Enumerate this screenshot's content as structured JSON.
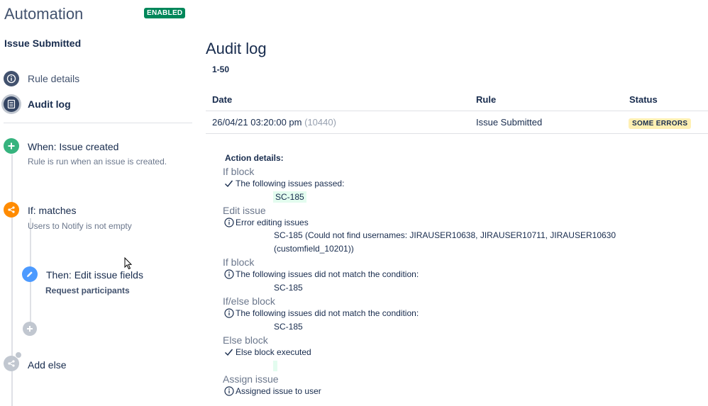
{
  "sidebar": {
    "app_title": "Automation",
    "status_badge": "ENABLED",
    "rule_name": "Issue Submitted",
    "nav": [
      {
        "label": "Rule details",
        "icon": "info-icon"
      },
      {
        "label": "Audit log",
        "icon": "list-icon",
        "active": true
      }
    ],
    "components": [
      {
        "type": "trigger",
        "title": "When: Issue created",
        "subtitle": "Rule is run when an issue is created.",
        "icon": "plus-icon",
        "color": "#36b37e"
      },
      {
        "type": "condition",
        "title": "If: matches",
        "subtitle": "Users to Notify is not empty",
        "icon": "branch-icon",
        "color": "#ff8b00"
      },
      {
        "type": "action",
        "title": "Then: Edit issue fields",
        "subtitle": "Request participants",
        "icon": "pencil-icon",
        "color": "#4c9aff"
      },
      {
        "type": "add",
        "icon": "plus-icon",
        "color": "#c1c7d0"
      },
      {
        "type": "else",
        "title": "Add else",
        "icon": "branch-icon",
        "color": "#c1c7d0"
      }
    ]
  },
  "main": {
    "title": "Audit log",
    "range": "1-50",
    "columns": {
      "date": "Date",
      "rule": "Rule",
      "status": "Status"
    },
    "row": {
      "date": "26/04/21 03:20:00 pm",
      "id": "(10440)",
      "rule": "Issue Submitted",
      "status": "SOME ERRORS"
    },
    "details": {
      "heading": "Action details:",
      "blocks": [
        {
          "title": "If block",
          "icon": "check-icon",
          "message": "The following issues passed:",
          "issue": "SC-185"
        },
        {
          "title": "Edit issue",
          "icon": "info-icon",
          "message": "Error editing issues",
          "issue_line1": "SC-185 (Could not find usernames: JIRAUSER10638, JIRAUSER10711, JIRAUSER10630",
          "issue_line2": "(customfield_10201))"
        },
        {
          "title": "If block",
          "icon": "info-icon",
          "message": "The following issues did not match the condition:",
          "issue": "SC-185"
        },
        {
          "title": "If/else block",
          "icon": "info-icon",
          "message": "The following issues did not match the condition:",
          "issue": "SC-185"
        },
        {
          "title": "Else block",
          "icon": "check-icon",
          "message": "Else block executed"
        },
        {
          "title": "Assign issue",
          "icon": "info-icon",
          "message": "Assigned issue to user"
        }
      ]
    }
  },
  "colors": {
    "enabled": "#00875a",
    "lozenge_warning": "#fff0b3",
    "success_highlight": "#e3fcef"
  }
}
